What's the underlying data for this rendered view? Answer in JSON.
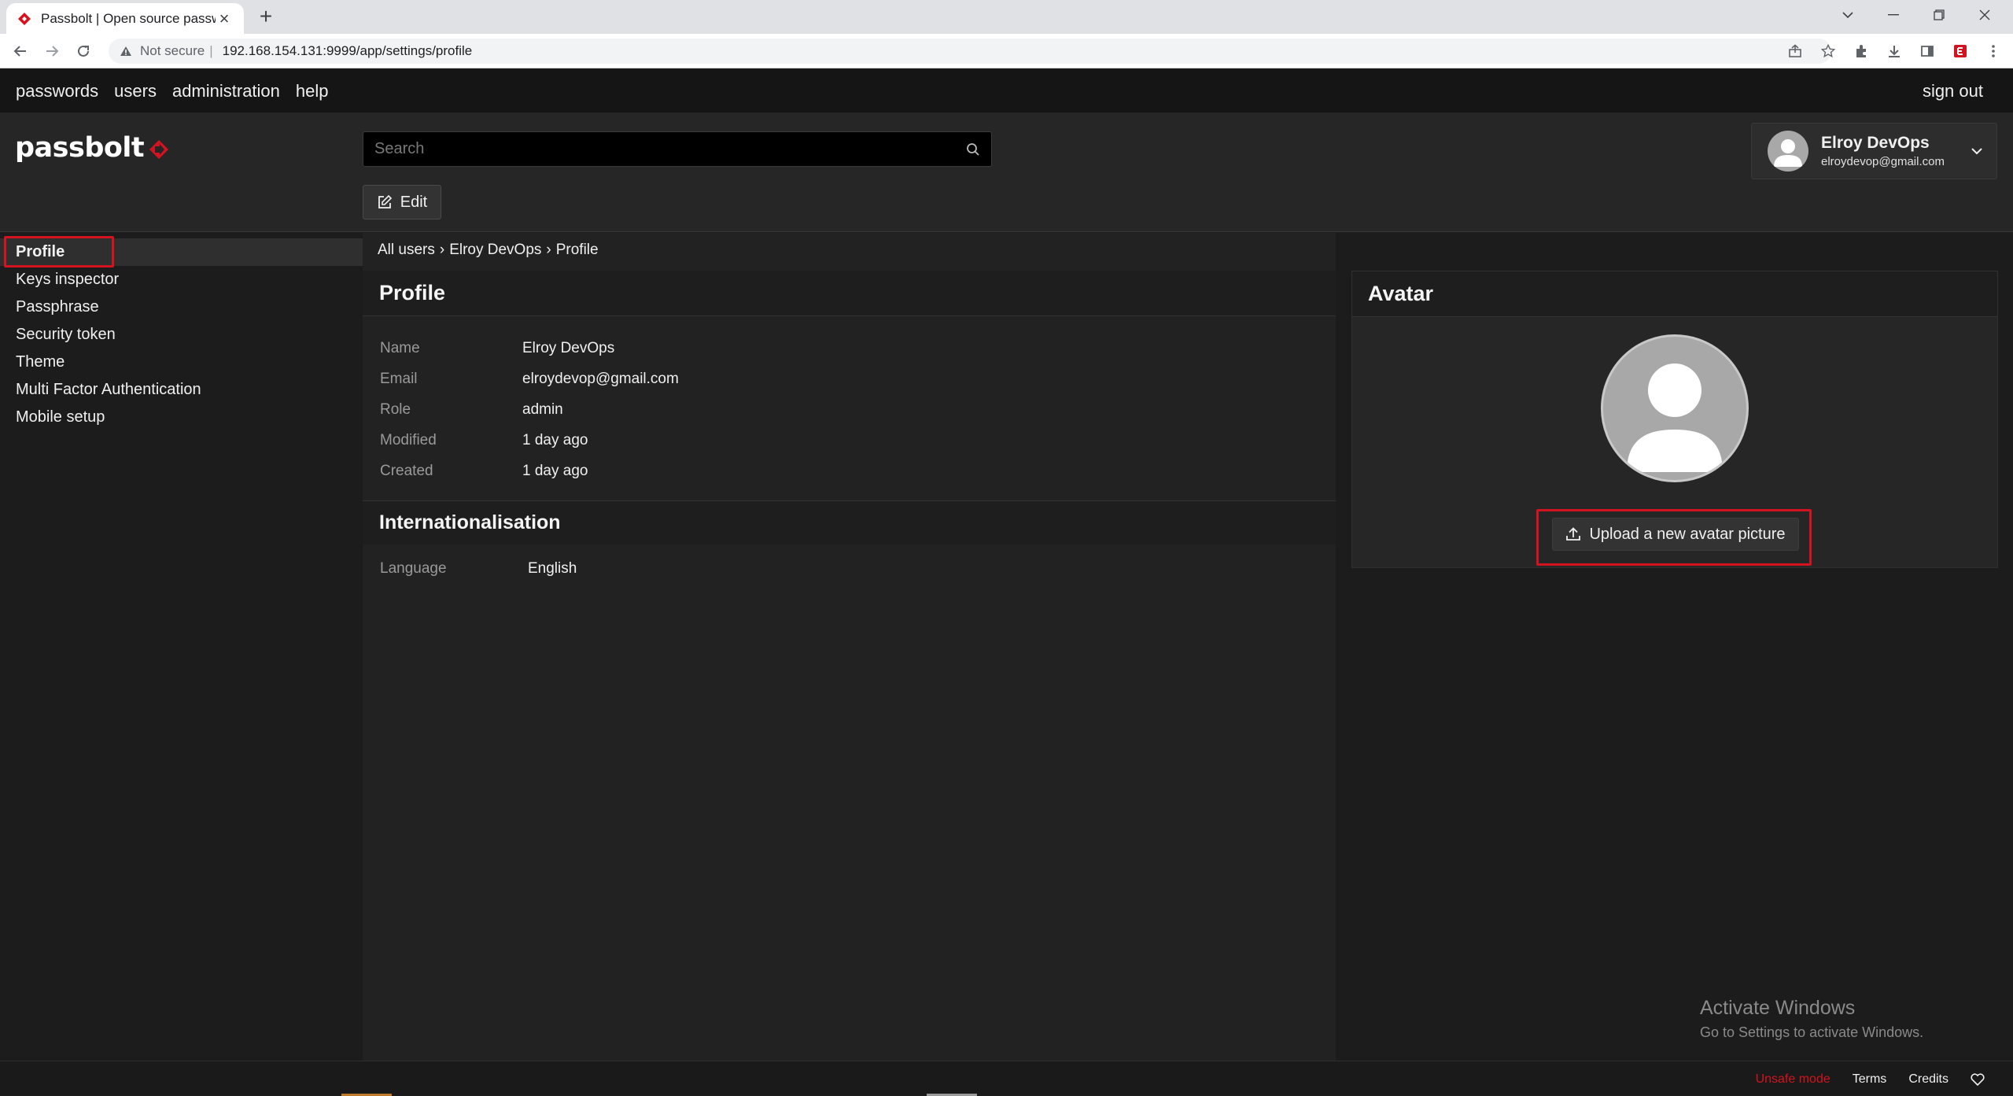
{
  "browser": {
    "tab_title": "Passbolt | Open source passwor",
    "url_not_secure": "Not secure",
    "url_separator": "|",
    "url": "192.168.154.131:9999/app/settings/profile"
  },
  "topnav": {
    "items": [
      "passwords",
      "users",
      "administration",
      "help"
    ],
    "sign_out": "sign out"
  },
  "header": {
    "logo_text": "passbolt",
    "search_placeholder": "Search",
    "edit_label": "Edit",
    "user_name": "Elroy DevOps",
    "user_email": "elroydevop@gmail.com"
  },
  "sidebar": {
    "items": [
      {
        "label": "Profile",
        "active": true
      },
      {
        "label": "Keys inspector"
      },
      {
        "label": "Passphrase"
      },
      {
        "label": "Security token"
      },
      {
        "label": "Theme"
      },
      {
        "label": "Multi Factor Authentication"
      },
      {
        "label": "Mobile setup"
      }
    ]
  },
  "breadcrumb": {
    "items": [
      "All users",
      "Elroy DevOps",
      "Profile"
    ],
    "separator": "›"
  },
  "profile": {
    "title": "Profile",
    "fields": [
      {
        "key": "Name",
        "value": "Elroy DevOps"
      },
      {
        "key": "Email",
        "value": "elroydevop@gmail.com"
      },
      {
        "key": "Role",
        "value": "admin"
      },
      {
        "key": "Modified",
        "value": "1 day ago"
      },
      {
        "key": "Created",
        "value": "1 day ago"
      }
    ]
  },
  "internationalisation": {
    "title": "Internationalisation",
    "language_key": "Language",
    "language_value": "English"
  },
  "avatar": {
    "title": "Avatar",
    "upload_label": "Upload a new avatar picture"
  },
  "watermark": {
    "line1": "Activate Windows",
    "line2": "Go to Settings to activate Windows."
  },
  "footer": {
    "unsafe_mode": "Unsafe mode",
    "terms": "Terms",
    "credits": "Credits"
  },
  "colors": {
    "accent_red": "#d3131f",
    "background": "#1c1c1c",
    "topnav": "#151515"
  }
}
